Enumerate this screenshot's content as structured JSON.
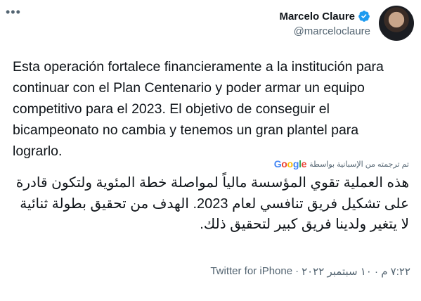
{
  "more_icon": "more-dots-icon",
  "author": {
    "name": "Marcelo Claure",
    "handle": "@marceloclaure",
    "verified_icon": "verified-badge-icon",
    "verified_color": "#1d9bf0"
  },
  "tweet": {
    "original_text": "Esta operación fortalece financieramente a la institución para continuar con el Plan Centenario y poder armar un equipo competitivo para el 2023. El objetivo de conseguir el bicampeonato no cambia y tenemos un gran plantel para lograrlo.",
    "translated_by_label": "تم ترجمته من الإسبانية بواسطة",
    "translator": "Google",
    "translated_text": "هذه العملية تقوي المؤسسة مالياً لمواصلة خطة المئوية ولتكون قادرة على تشكيل فريق تنافسي لعام 2023. الهدف من تحقيق بطولة ثنائية لا يتغير ولدينا فريق كبير لتحقيق ذلك."
  },
  "meta": {
    "source": "Twitter for iPhone",
    "separator": "·",
    "date": "٧:٢٢ م · ١٠ سبتمبر ٢٠٢٢"
  }
}
